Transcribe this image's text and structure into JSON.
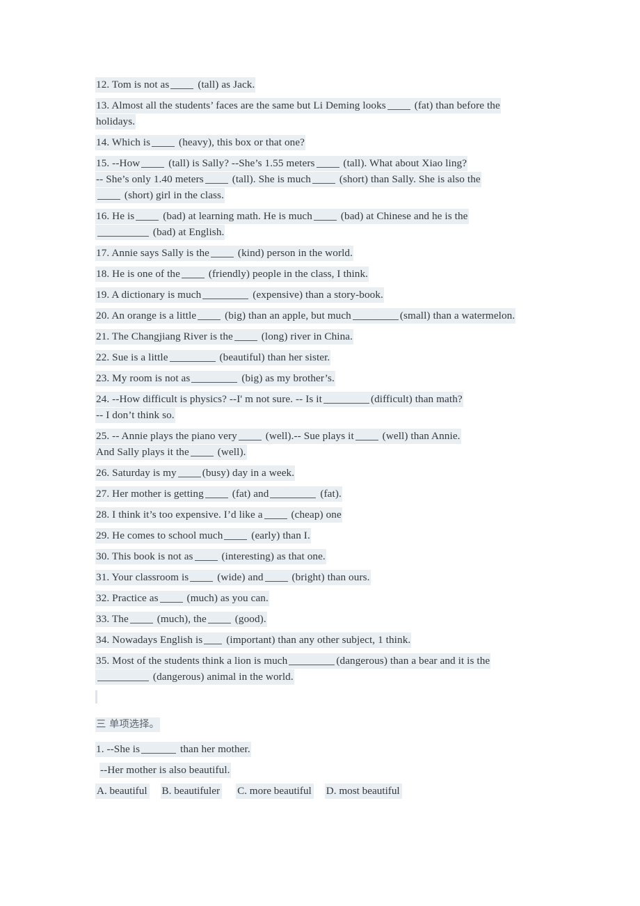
{
  "document": {
    "type": "english-grammar-worksheet",
    "highlight_color": "#e9eef3",
    "text_color": "#33383d"
  },
  "exercise_fill_in": {
    "items": [
      {
        "n": "12.",
        "pre": "12. Tom is not as",
        "blank": "b4",
        "post": "(tall) as Jack."
      },
      {
        "n": "13.",
        "pre": "13. Almost all the students’ faces are the same but Li Deming looks",
        "blank": "b4",
        "post": "(fat) than before the",
        "cont": "holidays."
      },
      {
        "n": "14.",
        "pre": "14. Which is",
        "blank": "b4",
        "post": "(heavy), this box or that one?"
      },
      {
        "n": "15.",
        "pre": "15. --How",
        "blank": "b4",
        "mid1": "(tall) is Sally?   --She’s 1.55 meters",
        "blank2": "b4",
        "post": "(tall). What about Xiao ling?",
        "line2_a": "-- She’s only 1.40 meters",
        "line2_b": "(tall). She is much",
        "line2_c": "(short) than Sally. She is also the",
        "line3_b": "(short) girl in the class."
      },
      {
        "n": "16.",
        "pre": "16. He is",
        "mid1": "(bad) at learning math. He is much",
        "post": "(bad) at Chinese and he is the",
        "line2": "(bad) at English."
      },
      {
        "n": "17.",
        "pre": "17. Annie says Sally is the",
        "blank": "b4",
        "post": "(kind) person in the world."
      },
      {
        "n": "18.",
        "pre": "18. He is one of the",
        "blank": "b4",
        "post": "(friendly) people in the class, I think."
      },
      {
        "n": "19.",
        "pre": "19. A dictionary is much",
        "blank": "b8",
        "post": "(expensive) than a story-book."
      },
      {
        "n": "20.",
        "pre": "20. An orange is a little",
        "mid1": "(big) than an apple, but much",
        "post": "(small) than a watermelon."
      },
      {
        "n": "21.",
        "pre": "21. The Changjiang River is the",
        "blank": "b4",
        "post": "(long) river in China."
      },
      {
        "n": "22.",
        "pre": "22. Sue is a little",
        "blank": "b8",
        "post": "(beautiful) than her sister."
      },
      {
        "n": "23.",
        "pre": "23. My room is not as",
        "blank": "b8",
        "post": "(big) as my brother’s."
      },
      {
        "n": "24.",
        "pre": "24. --How difficult is physics? --I' m not sure. -- Is it",
        "blank": "b8",
        "post": "(difficult) than math?",
        "cont": "-- I don’t think so."
      },
      {
        "n": "25.",
        "pre": "25. -- Annie plays the piano very",
        "mid1": "(well).-- Sue plays it",
        "post": "(well) than Annie.",
        "line2_a": "And Sally plays it the",
        "line2_b": "(well)."
      },
      {
        "n": "26.",
        "pre": "26. Saturday is my",
        "blank": "b4",
        "post": "(busy) day in a week."
      },
      {
        "n": "27.",
        "pre": "27. Her mother is getting",
        "mid1": "(fat) and",
        "post": "(fat)."
      },
      {
        "n": "28.",
        "pre": "28. I think it’s too expensive. I’d like a",
        "blank": "b4",
        "post": "(cheap) one"
      },
      {
        "n": "29.",
        "pre": "29. He comes to school much",
        "blank": "b4",
        "post": "(early) than I."
      },
      {
        "n": "30.",
        "pre": "30. This book is not as",
        "blank": "b4",
        "post": "(interesting) as that one."
      },
      {
        "n": "31.",
        "pre": "31. Your classroom is",
        "mid1": "(wide) and",
        "post": "(bright) than ours."
      },
      {
        "n": "32.",
        "pre": "32. Practice as",
        "blank": "b4",
        "post": "(much) as you can."
      },
      {
        "n": "33.",
        "pre": "33. The",
        "mid1": "(much), the",
        "post": "(good)."
      },
      {
        "n": "34.",
        "pre": "34. Nowadays English is",
        "blank": "b3",
        "post": "(important) than any other subject, 1 think."
      },
      {
        "n": "35.",
        "pre": "35. Most of the students think a lion is much",
        "mid1": "(dangerous) than a bear and it is the",
        "line2": "(dangerous) animal in the world."
      }
    ]
  },
  "section_three": {
    "heading": "三  单项选择。",
    "question_1": {
      "stem_a": "1. --She is",
      "stem_b": "than her mother.",
      "reply": "--Her mother is also beautiful.",
      "options": [
        "A. beautiful",
        "B. beautifuler",
        "C. more beautiful",
        "D. most beautiful"
      ]
    }
  }
}
